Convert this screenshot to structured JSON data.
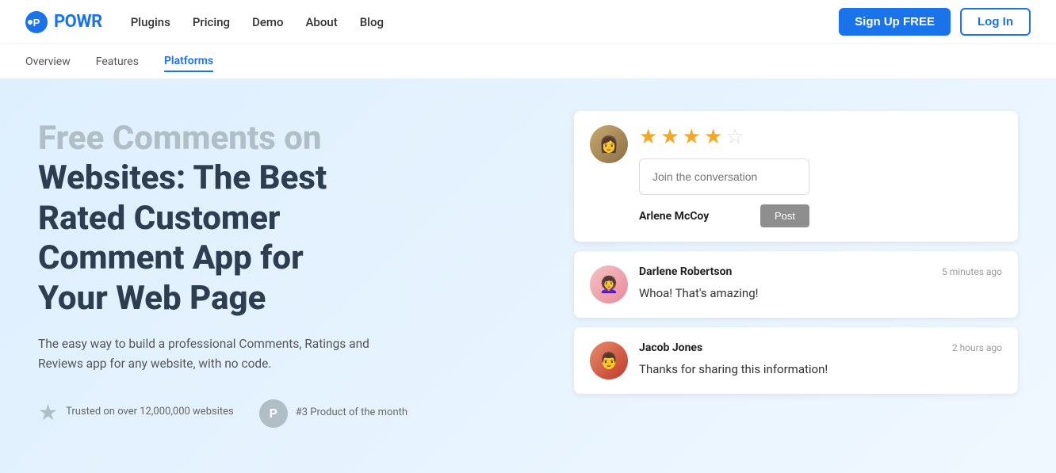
{
  "navbar": {
    "logo_text": "POWR",
    "nav_links": [
      {
        "label": "Plugins",
        "href": "#"
      },
      {
        "label": "Pricing",
        "href": "#"
      },
      {
        "label": "Demo",
        "href": "#"
      },
      {
        "label": "About",
        "href": "#"
      },
      {
        "label": "Blog",
        "href": "#"
      }
    ],
    "signup_label": "Sign Up FREE",
    "login_label": "Log In"
  },
  "subnav": {
    "items": [
      {
        "label": "Overview",
        "active": false
      },
      {
        "label": "Features",
        "active": false
      },
      {
        "label": "Platforms",
        "active": true
      }
    ]
  },
  "hero": {
    "title_gray": "Free Comments on",
    "title_dark": "Websites: The Best Rated Customer Comment App for Your Web Page",
    "subtitle": "The easy way to build a professional Comments, Ratings and Reviews app for any website, with no code.",
    "stat1_text": "Trusted on over 12,000,000 websites",
    "stat2_text": "#3 Product of the month"
  },
  "widget": {
    "stars": [
      true,
      true,
      true,
      true,
      false
    ],
    "input_placeholder": "Join the conversation",
    "first_author": "Arlene McCoy",
    "post_btn": "Post",
    "comments": [
      {
        "author": "Darlene Robertson",
        "time": "5 minutes ago",
        "text": "Whoa! That's amazing!"
      },
      {
        "author": "Jacob Jones",
        "time": "2 hours ago",
        "text": "Thanks for sharing this information!"
      }
    ]
  }
}
